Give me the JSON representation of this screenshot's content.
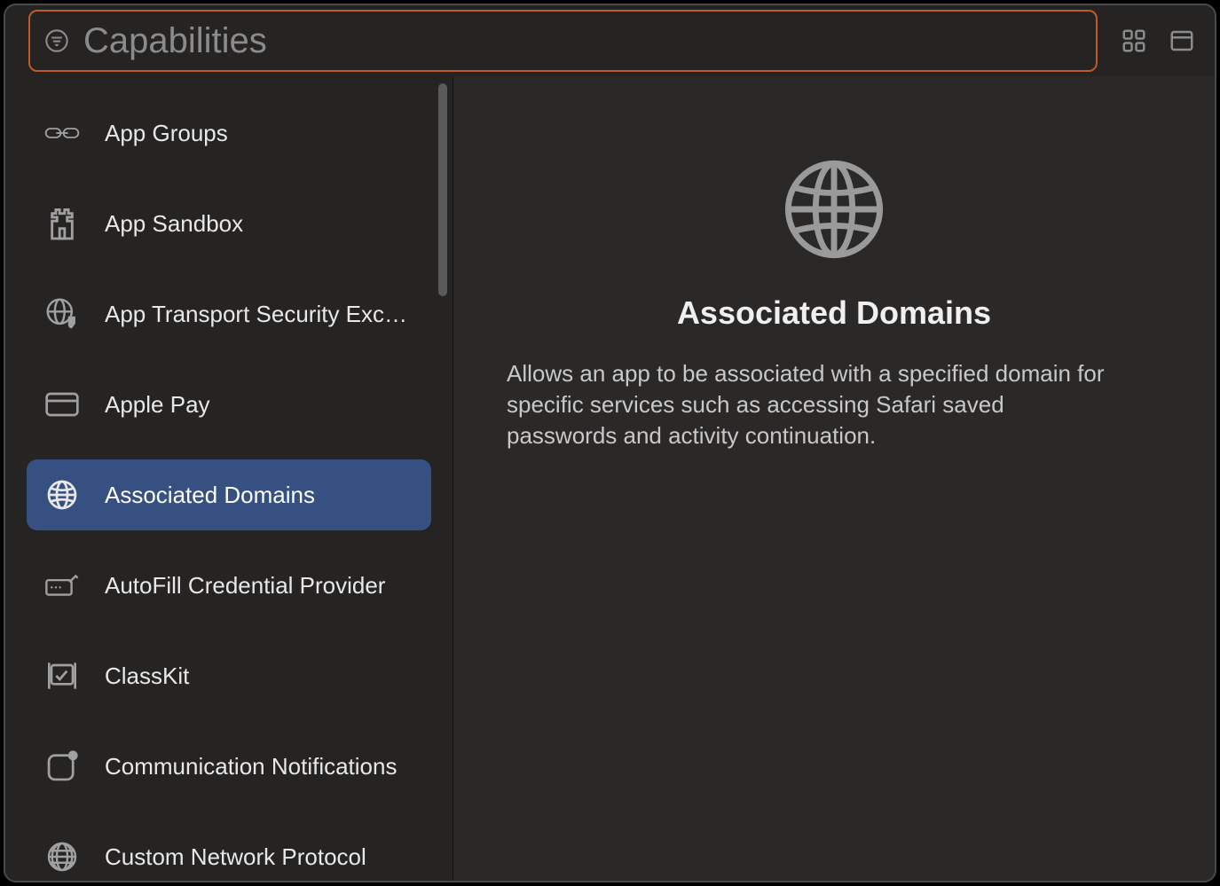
{
  "header": {
    "search_placeholder": "Capabilities",
    "search_value": ""
  },
  "sidebar": {
    "items": [
      {
        "icon": "link-icon",
        "label": "App Groups",
        "selected": false
      },
      {
        "icon": "castle-icon",
        "label": "App Sandbox",
        "selected": false
      },
      {
        "icon": "globe-shield-icon",
        "label": "App Transport Security Exce…",
        "selected": false
      },
      {
        "icon": "credit-card-icon",
        "label": "Apple Pay",
        "selected": false
      },
      {
        "icon": "globe-icon",
        "label": "Associated Domains",
        "selected": true
      },
      {
        "icon": "autofill-icon",
        "label": "AutoFill Credential Provider",
        "selected": false
      },
      {
        "icon": "classkit-icon",
        "label": "ClassKit",
        "selected": false
      },
      {
        "icon": "notification-app-icon",
        "label": "Communication Notifications",
        "selected": false
      },
      {
        "icon": "globe-network-icon",
        "label": "Custom Network Protocol",
        "selected": false
      }
    ]
  },
  "detail": {
    "title": "Associated Domains",
    "description": "Allows an app to be associated with a specified domain for specific services such as accessing Safari saved passwords and activity continuation."
  }
}
